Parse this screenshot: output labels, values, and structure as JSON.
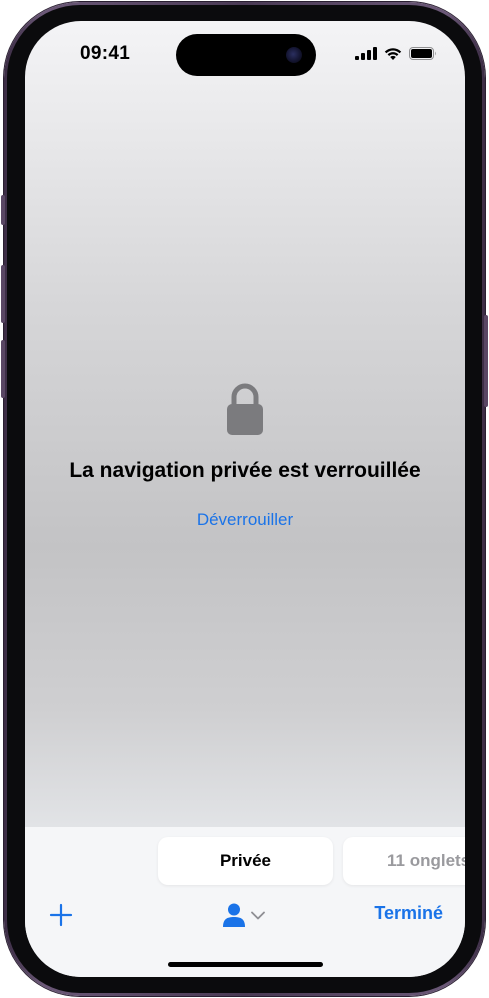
{
  "status_bar": {
    "time": "09:41",
    "icons": [
      "cellular-signal-icon",
      "wifi-icon",
      "battery-icon"
    ]
  },
  "locked": {
    "icon": "lock-icon",
    "title": "La navigation privée est verrouillée",
    "unlock_label": "Déverrouiller"
  },
  "toolbar": {
    "segments": [
      {
        "label": "Privée",
        "selected": true
      },
      {
        "label": "11 onglets",
        "selected": false
      }
    ],
    "add_icon": "plus-icon",
    "profile_icon": "person-icon",
    "profile_chevron": "chevron-down-icon",
    "done_label": "Terminé"
  },
  "colors": {
    "accent": "#1a73e8",
    "lock_gray": "#7b7b7e",
    "device_frame": "#4a3a54"
  }
}
